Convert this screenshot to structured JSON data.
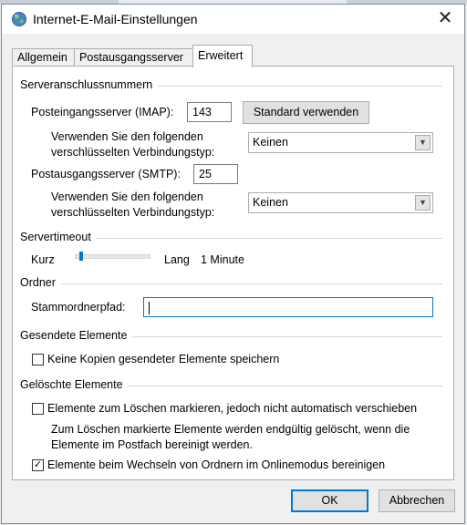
{
  "dialog": {
    "title": "Internet-E-Mail-Einstellungen",
    "close_glyph": "✕",
    "icon": "globe-icon"
  },
  "tabs": [
    {
      "label": "Allgemein",
      "active": false
    },
    {
      "label": "Postausgangsserver",
      "active": false
    },
    {
      "label": "Erweitert",
      "active": true
    }
  ],
  "server_ports": {
    "group_title": "Serveranschlussnummern",
    "incoming_label": "Posteingangsserver (IMAP):",
    "incoming_value": "143",
    "default_button": "Standard verwenden",
    "incoming_enc_label_1": "Verwenden Sie den folgenden",
    "incoming_enc_label_2": "verschlüsselten Verbindungstyp:",
    "incoming_enc_value": "Keinen",
    "outgoing_label": "Postausgangsserver (SMTP):",
    "outgoing_value": "25",
    "outgoing_enc_label_1": "Verwenden Sie den folgenden",
    "outgoing_enc_label_2": "verschlüsselten Verbindungstyp:",
    "outgoing_enc_value": "Keinen"
  },
  "timeout": {
    "group_title": "Servertimeout",
    "short_label": "Kurz",
    "long_label": "Lang",
    "value_label": "1 Minute",
    "slider_position": 0.05
  },
  "folders": {
    "group_title": "Ordner",
    "root_path_label": "Stammordnerpfad:",
    "root_path_value": ""
  },
  "sent_items": {
    "group_title": "Gesendete Elemente",
    "no_copies_label": "Keine Kopien gesendeter Elemente speichern",
    "no_copies_checked": false
  },
  "deleted_items": {
    "group_title": "Gelöschte Elemente",
    "mark_label": "Elemente zum Löschen markieren, jedoch nicht automatisch verschieben",
    "mark_checked": false,
    "info_line_1": "Zum Löschen markierte Elemente werden endgültig gelöscht, wenn die",
    "info_line_2": "Elemente im Postfach bereinigt werden.",
    "purge_label": "Elemente beim Wechseln von Ordnern im Onlinemodus bereinigen",
    "purge_checked": true,
    "check_glyph": "✓"
  },
  "buttons": {
    "ok": "OK",
    "cancel": "Abbrechen"
  },
  "colors": {
    "accent": "#0078d7",
    "dialog_bg": "#f0f0f0",
    "panel_bg": "#ffffff"
  }
}
